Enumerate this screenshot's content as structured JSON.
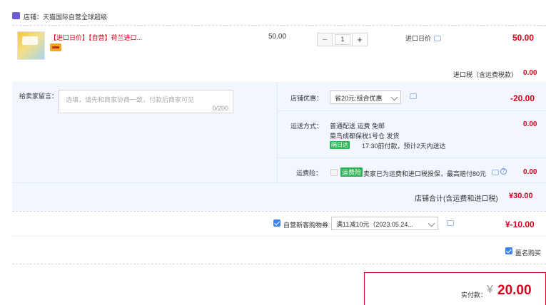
{
  "shop": {
    "label": "店铺：",
    "name": "天猫国际自营全球超级"
  },
  "product": {
    "title": "【进口日价】【自营】荷兰进口...",
    "price": "50.00",
    "quantity": "1",
    "price_type": "进口日价",
    "subtotal": "50.00"
  },
  "tax": {
    "label": "进口税（含运费税款）",
    "value": "0.00"
  },
  "message": {
    "label": "给卖家留言：",
    "placeholder": "选填，请先和商家协商一致，付款后商家可见",
    "counter": "0/200"
  },
  "discount": {
    "label": "店铺优惠：",
    "selected": "省20元:组合优惠",
    "value": "-20.00"
  },
  "shipping": {
    "label": "运送方式：",
    "line1": "普通配送 运费 免邮",
    "line2": "菜鸟成都保税1号仓  发货",
    "badge": "隔日达",
    "eta": "17:30前付款，预计2天内送达",
    "value": "0.00"
  },
  "insurance": {
    "label": "运费险：",
    "tag": "运费险",
    "text": "卖家已为运费和进口税投保，最高赔付80元",
    "value": "0.00"
  },
  "shop_total": {
    "label": "店铺合计(含运费和进口税)",
    "value": "¥30.00"
  },
  "coupon": {
    "label": "自营新客购物券",
    "selected": "满11减10元（2023.05.24...",
    "value": "¥-10.00"
  },
  "anonymous": {
    "label": "匿名购买"
  },
  "payment": {
    "label": "实付款：",
    "currency": "¥",
    "amount": "20.00"
  },
  "colors": {
    "accent": "#d9001b",
    "checkbox": "#3b82f6",
    "panel": "#f2f7ff",
    "green": "#2bb352"
  },
  "icons": [
    "shop-icon",
    "chat-icon",
    "help-icon",
    "chevron-down-icon",
    "check-icon"
  ]
}
